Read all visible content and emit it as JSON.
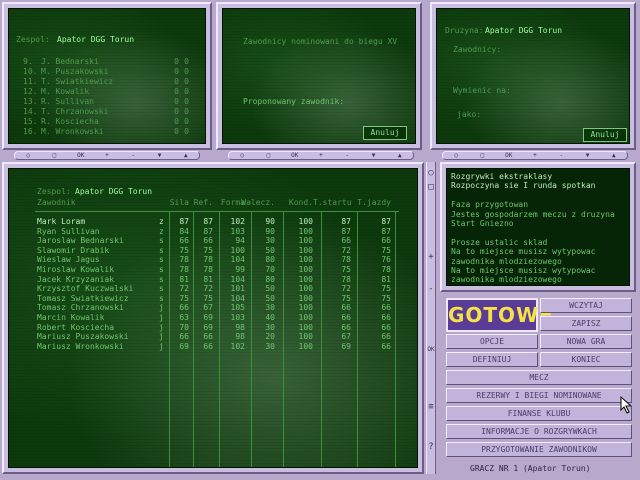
{
  "panel1": {
    "label": "Zespol:",
    "team": "Apator DGG Torun",
    "riders": [
      {
        "num": "9.",
        "name": "J. Bednarski",
        "a": "0",
        "b": "0"
      },
      {
        "num": "10.",
        "name": "M. Puszakowski",
        "a": "0",
        "b": "0"
      },
      {
        "num": "11.",
        "name": "T. Swiatkiewicz",
        "a": "0",
        "b": "0"
      },
      {
        "num": "12.",
        "name": "M. Kowalik",
        "a": "0",
        "b": "0"
      },
      {
        "num": "13.",
        "name": "R. Sullivan",
        "a": "0",
        "b": "0"
      },
      {
        "num": "14.",
        "name": "T. Chrzanowski",
        "a": "0",
        "b": "0"
      },
      {
        "num": "15.",
        "name": "R. Kosciecha",
        "a": "0",
        "b": "0"
      },
      {
        "num": "16.",
        "name": "M. Wronkowski",
        "a": "0",
        "b": "0"
      }
    ]
  },
  "panel2": {
    "title": "Zawodnicy nominowani do biegu XV",
    "proposed": "Proponowany zawodnik:",
    "cancel": "Anuluj"
  },
  "panel3": {
    "label": "Druzyna:",
    "team": "Apator DGG Torun",
    "riders": "Zawodnicy:",
    "replace": "Wymienic na:",
    "as": "jako:",
    "cancel": "Anuluj"
  },
  "ctrl": {
    "ok": "OK",
    "plus": "+",
    "minus": "-"
  },
  "table": {
    "label": "Zespol:",
    "team": "Apator DGG Torun",
    "headers": [
      "Zawodnik",
      "Sila",
      "Ref.",
      "Forma",
      "Walecz.",
      "Kond.",
      "T.startu",
      "T.jazdy"
    ],
    "rows": [
      {
        "name": "Mark Loram",
        "t": "z",
        "v": [
          "87",
          "87",
          "102",
          "90",
          "100",
          "87",
          "87"
        ],
        "sel": true
      },
      {
        "name": "Ryan Sullivan",
        "t": "z",
        "v": [
          "84",
          "87",
          "103",
          "90",
          "100",
          "87",
          "87"
        ]
      },
      {
        "name": "Jaroslaw Bednarski",
        "t": "s",
        "v": [
          "66",
          "66",
          "94",
          "30",
          "100",
          "66",
          "66"
        ]
      },
      {
        "name": "Slawomir Drabik",
        "t": "s",
        "v": [
          "75",
          "75",
          "100",
          "50",
          "100",
          "72",
          "75"
        ]
      },
      {
        "name": "Wieslaw Jagus",
        "t": "s",
        "v": [
          "78",
          "78",
          "104",
          "80",
          "100",
          "78",
          "76"
        ]
      },
      {
        "name": "Miroslaw Kowalik",
        "t": "s",
        "v": [
          "78",
          "78",
          "99",
          "70",
          "100",
          "75",
          "78"
        ]
      },
      {
        "name": "Jacek Krzyzaniak",
        "t": "s",
        "v": [
          "81",
          "81",
          "104",
          "80",
          "100",
          "78",
          "81"
        ]
      },
      {
        "name": "Krzysztof Kuczwalski",
        "t": "s",
        "v": [
          "72",
          "72",
          "101",
          "50",
          "100",
          "72",
          "75"
        ]
      },
      {
        "name": "Tomasz Swiatkiewicz",
        "t": "s",
        "v": [
          "75",
          "75",
          "104",
          "50",
          "100",
          "75",
          "75"
        ]
      },
      {
        "name": "Tomasz Chrzanowski",
        "t": "j",
        "v": [
          "66",
          "67",
          "105",
          "30",
          "100",
          "66",
          "66"
        ]
      },
      {
        "name": "Marcin Kowalik",
        "t": "j",
        "v": [
          "63",
          "69",
          "103",
          "40",
          "100",
          "66",
          "66"
        ]
      },
      {
        "name": "Robert Kosciecha",
        "t": "j",
        "v": [
          "70",
          "69",
          "98",
          "30",
          "100",
          "66",
          "66"
        ]
      },
      {
        "name": "Mariusz Puszakowski",
        "t": "j",
        "v": [
          "66",
          "66",
          "98",
          "20",
          "100",
          "67",
          "66"
        ]
      },
      {
        "name": "Mariusz Wronkowski",
        "t": "j",
        "v": [
          "69",
          "66",
          "102",
          "30",
          "100",
          "69",
          "66"
        ]
      }
    ]
  },
  "side": {
    "plus": "+",
    "minus": "-",
    "ok": "OK",
    "question": "?"
  },
  "info": {
    "lines": [
      "Rozgrywki ekstraklasy",
      "Rozpoczyna sie I runda spotkan",
      "",
      "Faza przygotowan",
      "Jestes gospodarzem meczu z druzyna",
      "Start Gniezno",
      "",
      "Prosze ustalic sklad",
      "Na to miejsce musisz wytypowac",
      "zawodnika mlodziezowego",
      "Na to miejsce musisz wytypowac",
      "zawodnika mlodziezowego"
    ]
  },
  "buttons": {
    "gotowe": "GOTOWE",
    "wczytaj": "WCZYTAJ",
    "zapisz": "ZAPISZ",
    "opcje": "OPCJE",
    "nowa_gra": "NOWA GRA",
    "definiuj": "DEFINIUJ",
    "koniec": "KONIEC",
    "mecz": "MECZ",
    "rezerwy": "REZERWY I BIEGI NOMINOWANE",
    "finanse": "FINANSE KLUBU",
    "informacje": "INFORMACJE O ROZGRYWKACH",
    "przygotowanie": "PRZYGOTOWANIE ZAWODNIKOW"
  },
  "status": "GRACZ NR 1  (Apator Torun)"
}
